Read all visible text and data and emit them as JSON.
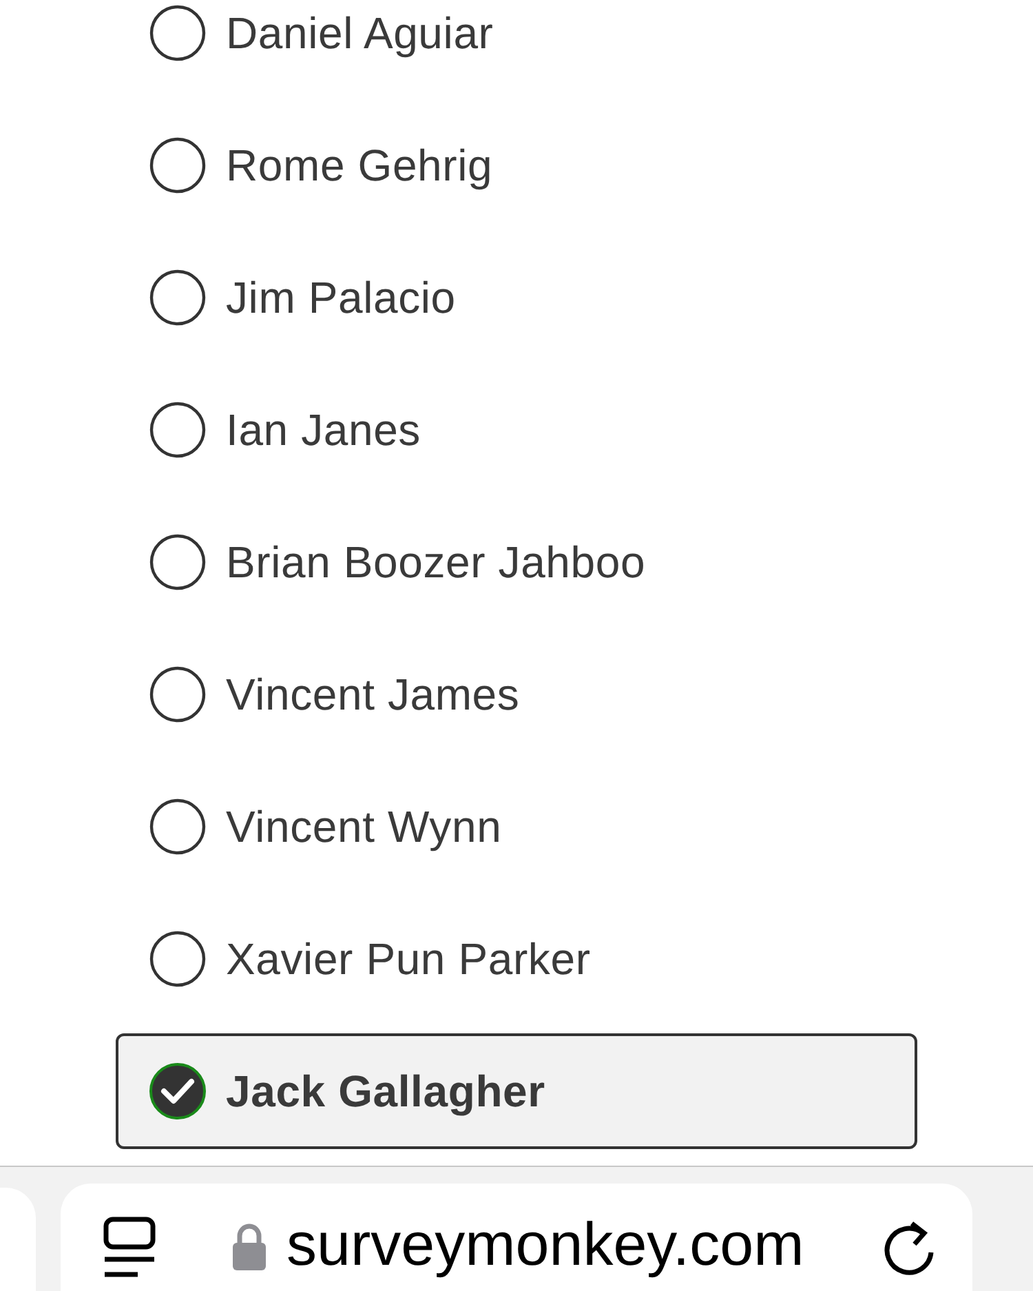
{
  "options": [
    {
      "label": "Daniel Aguiar",
      "selected": false
    },
    {
      "label": "Rome Gehrig",
      "selected": false
    },
    {
      "label": "Jim Palacio",
      "selected": false
    },
    {
      "label": "Ian Janes",
      "selected": false
    },
    {
      "label": "Brian Boozer Jahboo",
      "selected": false
    },
    {
      "label": "Vincent James",
      "selected": false
    },
    {
      "label": "Vincent Wynn",
      "selected": false
    },
    {
      "label": "Xavier Pun Parker",
      "selected": false
    },
    {
      "label": "Jack Gallagher",
      "selected": true
    }
  ],
  "address_bar": {
    "url": "surveymonkey.com"
  }
}
